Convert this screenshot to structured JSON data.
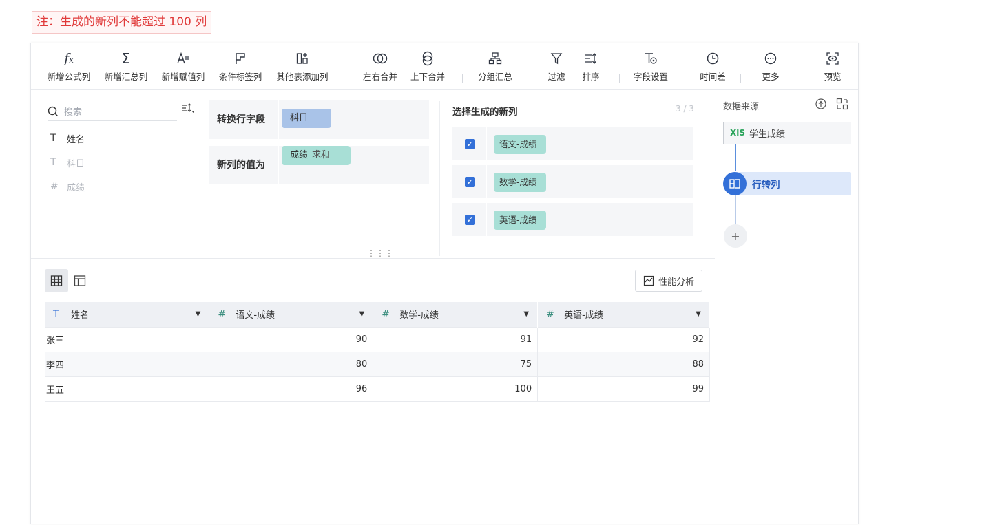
{
  "note": "注：生成的新列不能超过 100 列",
  "toolbar": {
    "items": [
      {
        "label": "新增公式列",
        "icon": "fx-icon"
      },
      {
        "label": "新增汇总列",
        "icon": "sigma-icon"
      },
      {
        "label": "新增赋值列",
        "icon": "assign-icon"
      },
      {
        "label": "条件标签列",
        "icon": "flag-icon"
      },
      {
        "label": "其他表添加列",
        "icon": "add-column-icon"
      },
      {
        "label": "左右合并",
        "icon": "merge-horizontal-icon"
      },
      {
        "label": "上下合并",
        "icon": "merge-vertical-icon"
      },
      {
        "label": "分组汇总",
        "icon": "group-icon"
      },
      {
        "label": "过滤",
        "icon": "filter-icon"
      },
      {
        "label": "排序",
        "icon": "sort-icon"
      },
      {
        "label": "字段设置",
        "icon": "field-settings-icon"
      },
      {
        "label": "时间差",
        "icon": "clock-icon"
      },
      {
        "label": "更多",
        "icon": "more-icon"
      },
      {
        "label": "预览",
        "icon": "preview-icon"
      }
    ]
  },
  "fields_panel": {
    "search_placeholder": "搜索",
    "fields": [
      {
        "name": "姓名",
        "type": "text",
        "enabled": true
      },
      {
        "name": "科目",
        "type": "text",
        "enabled": false
      },
      {
        "name": "成绩",
        "type": "number",
        "enabled": false
      }
    ]
  },
  "config": {
    "row_field_label": "转换行字段",
    "row_field_value": "科目",
    "value_label": "新列的值为",
    "value_field": "成绩",
    "value_agg": "求和"
  },
  "new_columns": {
    "title": "选择生成的新列",
    "count": "3 / 3",
    "items": [
      {
        "label": "语文-成绩",
        "checked": true
      },
      {
        "label": "数学-成绩",
        "checked": true
      },
      {
        "label": "英语-成绩",
        "checked": true
      }
    ]
  },
  "preview": {
    "perf_button": "性能分析",
    "columns": [
      {
        "label": "姓名",
        "type": "text"
      },
      {
        "label": "语文-成绩",
        "type": "number"
      },
      {
        "label": "数学-成绩",
        "type": "number"
      },
      {
        "label": "英语-成绩",
        "type": "number"
      }
    ],
    "rows": [
      [
        "张三",
        "90",
        "91",
        "92"
      ],
      [
        "李四",
        "80",
        "75",
        "88"
      ],
      [
        "王五",
        "96",
        "100",
        "99"
      ]
    ]
  },
  "sidebar": {
    "title": "数据来源",
    "source": "学生成绩",
    "source_tag": "XlS",
    "step": "行转列",
    "accent": "#3370d8"
  }
}
